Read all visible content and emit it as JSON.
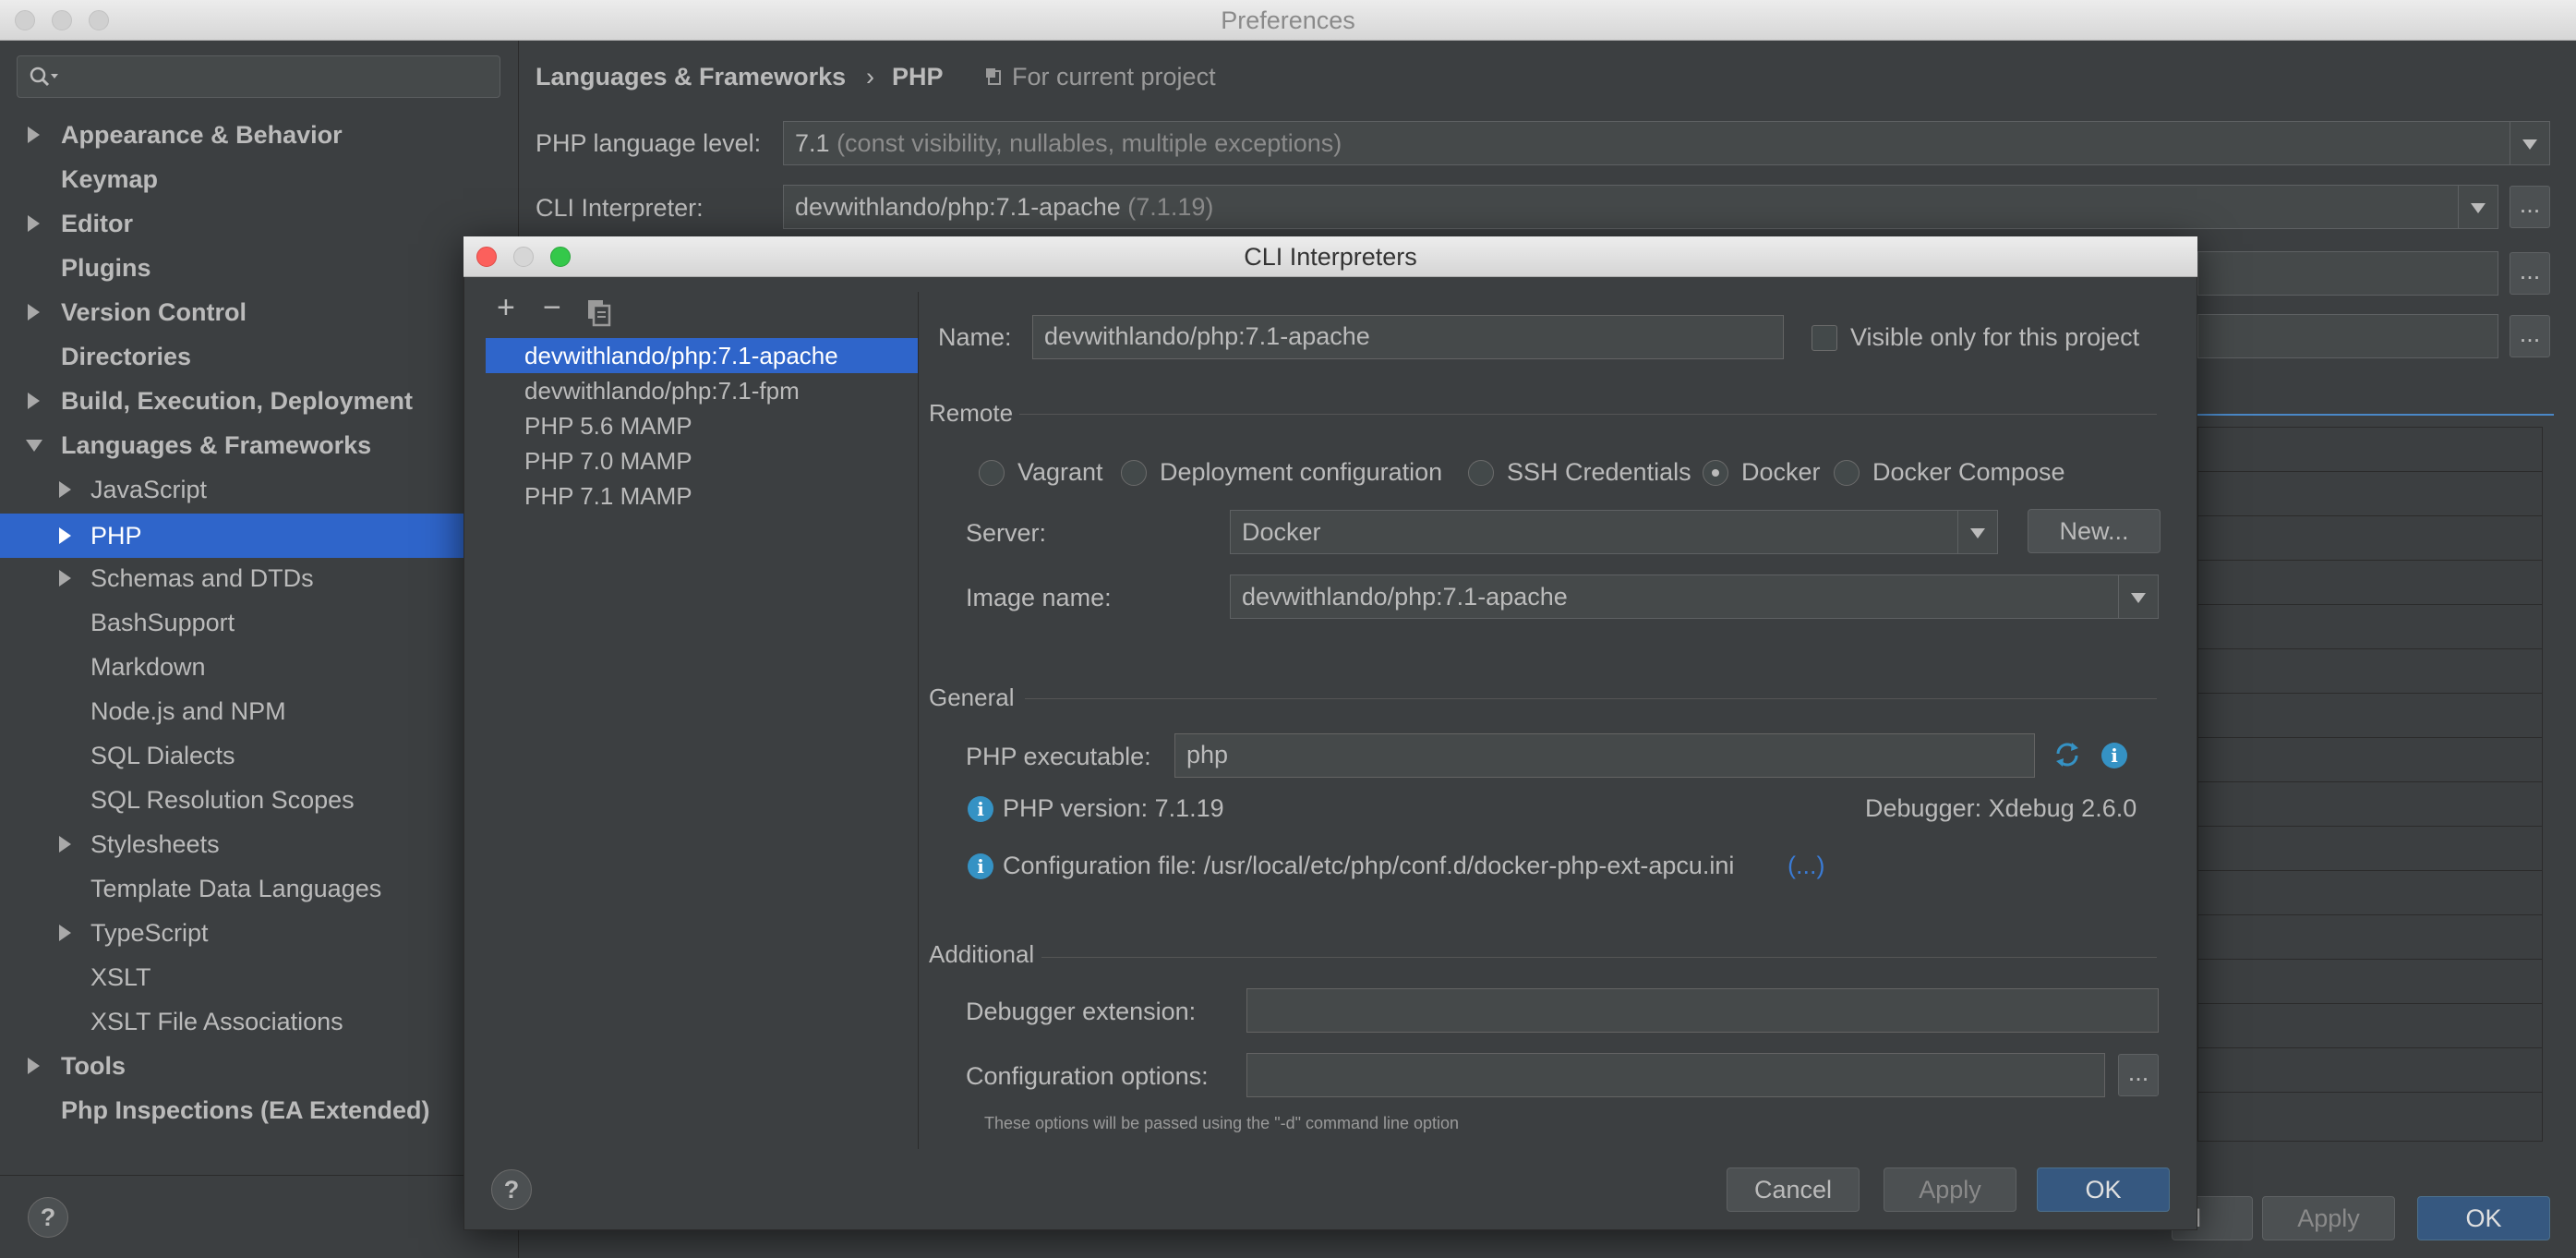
{
  "window": {
    "title": "Preferences"
  },
  "sidebar": {
    "items": [
      {
        "label": "Appearance & Behavior"
      },
      {
        "label": "Keymap"
      },
      {
        "label": "Editor"
      },
      {
        "label": "Plugins"
      },
      {
        "label": "Version Control"
      },
      {
        "label": "Directories"
      },
      {
        "label": "Build, Execution, Deployment"
      },
      {
        "label": "Languages & Frameworks"
      },
      {
        "label": "JavaScript"
      },
      {
        "label": "PHP"
      },
      {
        "label": "Schemas and DTDs"
      },
      {
        "label": "BashSupport"
      },
      {
        "label": "Markdown"
      },
      {
        "label": "Node.js and NPM"
      },
      {
        "label": "SQL Dialects"
      },
      {
        "label": "SQL Resolution Scopes"
      },
      {
        "label": "Stylesheets"
      },
      {
        "label": "Template Data Languages"
      },
      {
        "label": "TypeScript"
      },
      {
        "label": "XSLT"
      },
      {
        "label": "XSLT File Associations"
      },
      {
        "label": "Tools"
      },
      {
        "label": "Php Inspections (EA Extended)"
      }
    ]
  },
  "main": {
    "breadcrumb_parent": "Languages & Frameworks",
    "breadcrumb_sep": "›",
    "breadcrumb_current": "PHP",
    "scope_label": "For current project",
    "php_level_label": "PHP language level:",
    "php_level_value": "7.1",
    "php_level_desc": "(const visibility, nullables, multiple exceptions)",
    "cli_label": "CLI Interpreter:",
    "cli_value": "devwithlando/php:7.1-apache",
    "cli_version": "(7.1.19)",
    "dots": "...",
    "cancel_partial": "el",
    "apply": "Apply",
    "ok": "OK"
  },
  "dialog": {
    "title": "CLI Interpreters",
    "toolbar": {
      "add": "+",
      "remove": "−"
    },
    "interpreters": [
      "devwithlando/php:7.1-apache",
      "devwithlando/php:7.1-fpm",
      "PHP 5.6 MAMP",
      "PHP 7.0 MAMP",
      "PHP 7.1 MAMP"
    ],
    "name_label": "Name:",
    "name_value": "devwithlando/php:7.1-apache",
    "visible_only_label": "Visible only for this project",
    "remote_header": "Remote",
    "radios": [
      "Vagrant",
      "Deployment configuration",
      "SSH Credentials",
      "Docker",
      "Docker Compose"
    ],
    "selected_radio": "Docker",
    "server_label": "Server:",
    "server_value": "Docker",
    "new_button": "New...",
    "image_label": "Image name:",
    "image_value": "devwithlando/php:7.1-apache",
    "general_header": "General",
    "php_exe_label": "PHP executable:",
    "php_exe_value": "php",
    "php_version": "PHP version: 7.1.19",
    "debugger": "Debugger: Xdebug 2.6.0",
    "config_file": "Configuration file: /usr/local/etc/php/conf.d/docker-php-ext-apcu.ini",
    "config_more": "(...)",
    "additional_header": "Additional",
    "debugger_ext_label": "Debugger extension:",
    "config_opts_label": "Configuration options:",
    "hint": "These options will be passed using the \"-d\" command line option",
    "cancel": "Cancel",
    "apply": "Apply",
    "ok": "OK",
    "help": "?"
  }
}
